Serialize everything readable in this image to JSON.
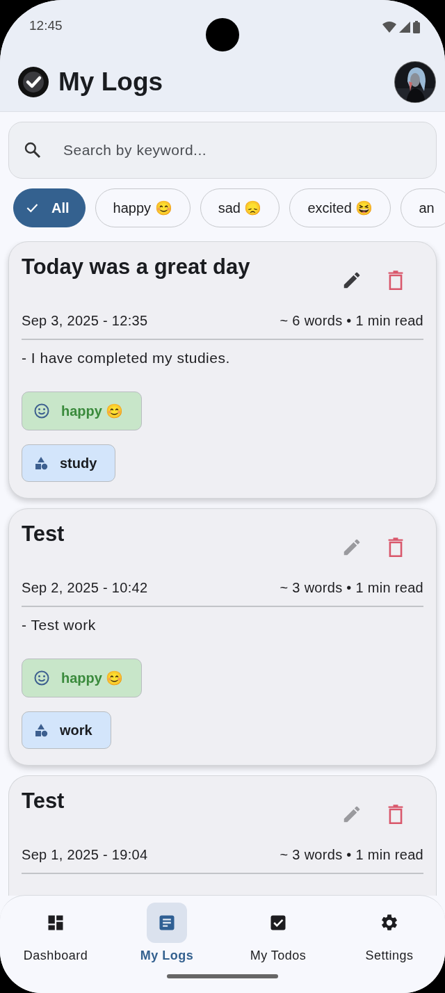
{
  "status_bar": {
    "time": "12:45"
  },
  "app_bar": {
    "title": "My Logs"
  },
  "search": {
    "placeholder": "Search by keyword..."
  },
  "filters": [
    {
      "label": "All",
      "selected": true
    },
    {
      "label": "happy 😊",
      "selected": false
    },
    {
      "label": "sad 😞",
      "selected": false
    },
    {
      "label": "excited 😆",
      "selected": false
    },
    {
      "label": "an",
      "selected": false
    }
  ],
  "logs": [
    {
      "title": "Today was a great day",
      "date": "Sep 3, 2025 - 12:35",
      "stats": "~ 6 words • 1 min read",
      "body": "- I have completed my studies.",
      "edit_active": true,
      "mood": "happy 😊",
      "tags": [
        "study"
      ]
    },
    {
      "title": "Test",
      "date": "Sep 2, 2025 - 10:42",
      "stats": "~ 3 words • 1 min read",
      "body": "- Test work",
      "edit_active": false,
      "mood": "happy 😊",
      "tags": [
        "work"
      ]
    },
    {
      "title": "Test",
      "date": "Sep 1, 2025 - 19:04",
      "stats": "~ 3 words • 1 min read",
      "edit_active": false
    }
  ],
  "nav": [
    {
      "label": "Dashboard",
      "selected": false
    },
    {
      "label": "My Logs",
      "selected": true
    },
    {
      "label": "My Todos",
      "selected": false
    },
    {
      "label": "Settings",
      "selected": false
    }
  ]
}
